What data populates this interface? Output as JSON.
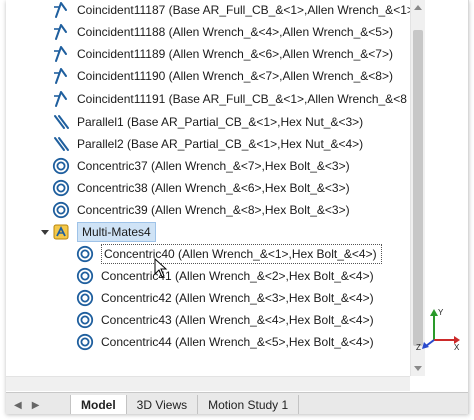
{
  "tree": {
    "items": [
      {
        "icon": "coincident-icon",
        "label": "Coincident11187 (Base AR_Full_CB_&<1>,Allen Wrench_&<1>"
      },
      {
        "icon": "coincident-icon",
        "label": "Coincident11188 (Allen Wrench_&<4>,Allen Wrench_&<5>)"
      },
      {
        "icon": "coincident-icon",
        "label": "Coincident11189 (Allen Wrench_&<6>,Allen Wrench_&<7>)"
      },
      {
        "icon": "coincident-icon",
        "label": "Coincident11190 (Allen Wrench_&<7>,Allen Wrench_&<8>)"
      },
      {
        "icon": "coincident-icon",
        "label": "Coincident11191 (Base AR_Full_CB_&<1>,Allen Wrench_&<8"
      },
      {
        "icon": "parallel-icon",
        "label": "Parallel1 (Base AR_Partial_CB_&<1>,Hex Nut_&<3>)"
      },
      {
        "icon": "parallel-icon",
        "label": "Parallel2 (Base AR_Partial_CB_&<1>,Hex Nut_&<4>)"
      },
      {
        "icon": "concentric-icon",
        "label": "Concentric37 (Allen Wrench_&<7>,Hex Bolt_&<3>)"
      },
      {
        "icon": "concentric-icon",
        "label": "Concentric38 (Allen Wrench_&<6>,Hex Bolt_&<3>)"
      },
      {
        "icon": "concentric-icon",
        "label": "Concentric39 (Allen Wrench_&<8>,Hex Bolt_&<3>)"
      }
    ],
    "group": {
      "icon": "multimate-icon",
      "label": "Multi-Mates4"
    },
    "children": [
      {
        "icon": "concentric-icon",
        "label": "Concentric40 (Allen Wrench_&<1>,Hex Bolt_&<4>)"
      },
      {
        "icon": "concentric-icon",
        "label": "Concentric41 (Allen Wrench_&<2>,Hex Bolt_&<4>)"
      },
      {
        "icon": "concentric-icon",
        "label": "Concentric42 (Allen Wrench_&<3>,Hex Bolt_&<4>)"
      },
      {
        "icon": "concentric-icon",
        "label": "Concentric43 (Allen Wrench_&<4>,Hex Bolt_&<4>)"
      },
      {
        "icon": "concentric-icon",
        "label": "Concentric44 (Allen Wrench_&<5>,Hex Bolt_&<4>)"
      }
    ]
  },
  "tabs": [
    {
      "label": "Model",
      "active": true
    },
    {
      "label": "3D Views",
      "active": false
    },
    {
      "label": "Motion Study 1",
      "active": false
    }
  ],
  "triad": {
    "y": "Y",
    "x": "X",
    "z": "Z"
  },
  "colors": {
    "accent": "#1f78c8",
    "selection": "#cfe3f6",
    "mate_icon": "#1f5f9e"
  }
}
